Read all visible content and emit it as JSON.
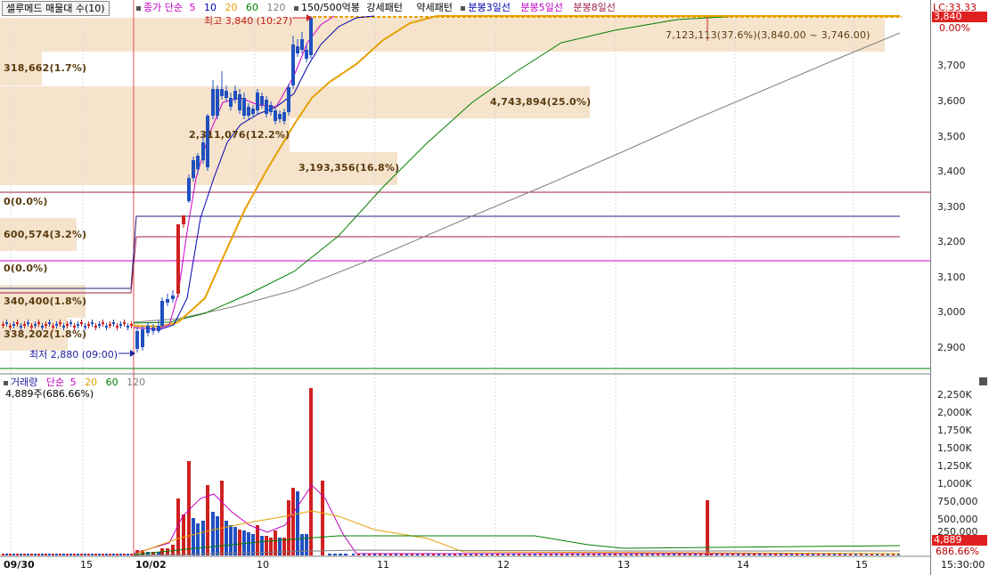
{
  "stock_selector": "셀루메드 매물대 수(10)",
  "price_legend": {
    "ma_label": "종가 단순",
    "periods": [
      "5",
      "10",
      "20",
      "60",
      "120"
    ],
    "period_colors": [
      "#d000d0",
      "#0000b0",
      "#e6a000",
      "#008000",
      "#808080"
    ],
    "ma_color": "#c000c0",
    "volume_pattern": "150/500억봉",
    "strong_pattern": "강세패턴",
    "weak_pattern": "약세패턴",
    "bun3": "분봉3일선",
    "bun5": "분봉5일선",
    "bun8": "분봉8일선"
  },
  "high_annotation": "최고 3,840 (10:27)",
  "low_annotation": "최저 2,880 (09:00)",
  "top_volume_range": "7,123,113(37.6%)(3,840.00 ~ 3,746.00)",
  "volume_profile": [
    {
      "label": "318,662(1.7%)"
    },
    {
      "label": "4,743,894(25.0%)"
    },
    {
      "label": "2,311,076(12.2%)"
    },
    {
      "label": "3,193,356(16.8%)"
    },
    {
      "label": "0(0.0%)"
    },
    {
      "label": "600,574(3.2%)"
    },
    {
      "label": "0(0.0%)"
    },
    {
      "label": "340,400(1.8%)"
    },
    {
      "label": "338,202(1.8%)"
    }
  ],
  "price_axis": {
    "ticks": [
      "3,700",
      "3,600",
      "3,500",
      "3,400",
      "3,300",
      "3,200",
      "3,100",
      "3,000",
      "2,900"
    ],
    "lc_label": "LC:33.33",
    "current_price": "3,840",
    "current_pct": "0.00%",
    "current_color": "#e02020"
  },
  "volume_legend": {
    "title": "거래량",
    "ma_label": "단순",
    "periods": [
      "5",
      "20",
      "60",
      "120"
    ],
    "period_colors": [
      "#c000c0",
      "#e6a000",
      "#008000",
      "#808080"
    ],
    "current_volume": "4,889주(686.66%)"
  },
  "volume_axis": {
    "ticks": [
      "2,250K",
      "2,000K",
      "1,750K",
      "1,500K",
      "1,250K",
      "1,000K",
      "750,000",
      "500,000",
      "250,000"
    ],
    "current_volume": "4,889",
    "current_pct": "686.66%"
  },
  "time_axis": {
    "labels": [
      "09/30",
      "15",
      "10/02",
      "10",
      "11",
      "12",
      "13",
      "14",
      "15"
    ],
    "current_time": "15:30:00"
  },
  "chart_data": {
    "type": "candlestick",
    "y_price_range": [
      2850,
      3860
    ],
    "y_volume_range": [
      0,
      2400000
    ],
    "price_levels": {
      "high": 3840,
      "low": 2880
    }
  }
}
